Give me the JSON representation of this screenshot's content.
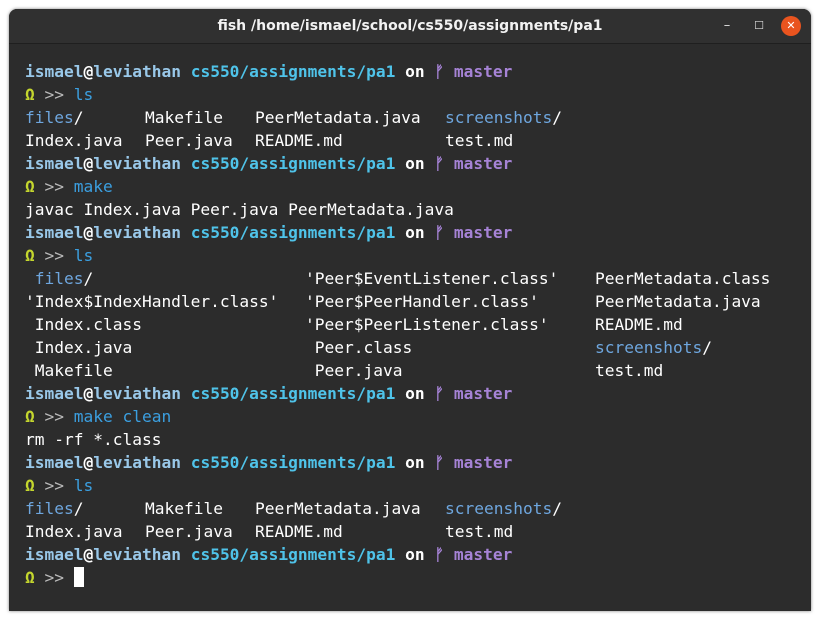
{
  "window": {
    "title": "fish /home/ismael/school/cs550/assignments/pa1",
    "controls": {
      "minimize": "–",
      "maximize": "☐",
      "close": "✕"
    }
  },
  "prompt": {
    "user": "ismael",
    "at": "@",
    "host": "leviathan",
    "path": "cs550/assignments/pa1",
    "on": "on",
    "branch_icon": "ᚠ",
    "branch": "master",
    "omega": "Ω",
    "chevrons": ">>"
  },
  "lines": [
    {
      "type": "prompt"
    },
    {
      "type": "command",
      "text": "ls"
    },
    {
      "type": "ls",
      "cols": [
        {
          "text": "files",
          "dir": true,
          "suffix": "/",
          "w": 120
        },
        {
          "text": "Makefile",
          "w": 110
        },
        {
          "text": "PeerMetadata.java",
          "w": 190
        },
        {
          "text": "screenshots",
          "dir": true,
          "suffix": "/"
        }
      ]
    },
    {
      "type": "ls",
      "cols": [
        {
          "text": "Index.java",
          "w": 120
        },
        {
          "text": "Peer.java",
          "w": 110
        },
        {
          "text": "README.md",
          "w": 190
        },
        {
          "text": "test.md"
        }
      ]
    },
    {
      "type": "prompt"
    },
    {
      "type": "command",
      "text": "make"
    },
    {
      "type": "output",
      "text": "javac Index.java Peer.java PeerMetadata.java"
    },
    {
      "type": "prompt"
    },
    {
      "type": "command",
      "text": "ls"
    },
    {
      "type": "ls",
      "cols": [
        {
          "text": " files",
          "dir": true,
          "suffix": "/",
          "w": 280
        },
        {
          "text": "'Peer$EventListener.class'",
          "w": 290
        },
        {
          "text": "PeerMetadata.class"
        }
      ]
    },
    {
      "type": "ls",
      "cols": [
        {
          "text": "'Index$IndexHandler.class'",
          "w": 280
        },
        {
          "text": "'Peer$PeerHandler.class'",
          "w": 290
        },
        {
          "text": "PeerMetadata.java"
        }
      ]
    },
    {
      "type": "ls",
      "cols": [
        {
          "text": " Index.class",
          "w": 280
        },
        {
          "text": "'Peer$PeerListener.class'",
          "w": 290
        },
        {
          "text": "README.md"
        }
      ]
    },
    {
      "type": "ls",
      "cols": [
        {
          "text": " Index.java",
          "w": 280
        },
        {
          "text": " Peer.class",
          "w": 290
        },
        {
          "text": "screenshots",
          "dir": true,
          "suffix": "/"
        }
      ]
    },
    {
      "type": "ls",
      "cols": [
        {
          "text": " Makefile",
          "w": 280
        },
        {
          "text": " Peer.java",
          "w": 290
        },
        {
          "text": "test.md"
        }
      ]
    },
    {
      "type": "prompt"
    },
    {
      "type": "command",
      "text": "make clean"
    },
    {
      "type": "output",
      "text": "rm -rf *.class"
    },
    {
      "type": "prompt"
    },
    {
      "type": "command",
      "text": "ls"
    },
    {
      "type": "ls",
      "cols": [
        {
          "text": "files",
          "dir": true,
          "suffix": "/",
          "w": 120
        },
        {
          "text": "Makefile",
          "w": 110
        },
        {
          "text": "PeerMetadata.java",
          "w": 190
        },
        {
          "text": "screenshots",
          "dir": true,
          "suffix": "/"
        }
      ]
    },
    {
      "type": "ls",
      "cols": [
        {
          "text": "Index.java",
          "w": 120
        },
        {
          "text": "Peer.java",
          "w": 110
        },
        {
          "text": "README.md",
          "w": 190
        },
        {
          "text": "test.md"
        }
      ]
    },
    {
      "type": "prompt"
    },
    {
      "type": "command",
      "text": "",
      "cursor": true
    }
  ]
}
